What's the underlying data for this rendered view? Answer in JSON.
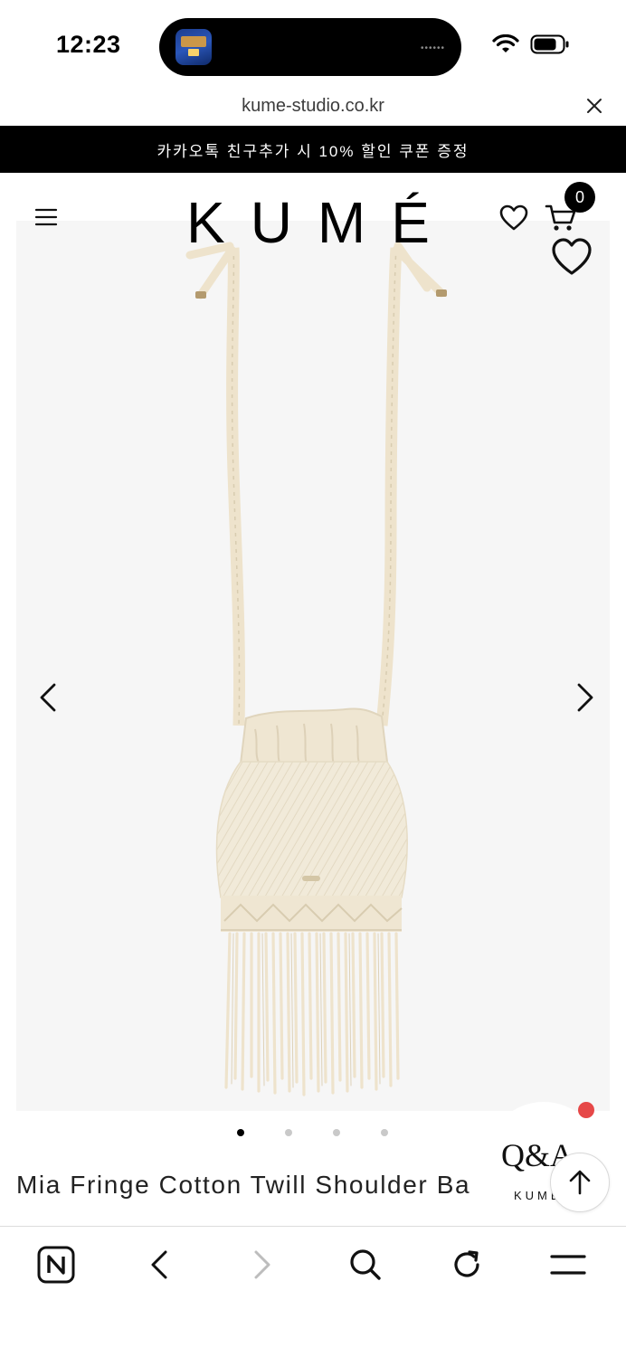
{
  "status_bar": {
    "time": "12:23"
  },
  "browser": {
    "url": "kume-studio.co.kr"
  },
  "promo": {
    "text": "카카오톡 친구추가 시 10% 할인 쿠폰 증정"
  },
  "header": {
    "logo": "KUMÉ",
    "cart_count": "0"
  },
  "gallery": {
    "current_index": 1,
    "total": 4
  },
  "product": {
    "title": "Mia Fringe Cotton Twill Shoulder Ba"
  },
  "qa": {
    "label": "Q&A",
    "sub": "KUME"
  },
  "colors": {
    "promo_bg": "#000000",
    "gallery_bg": "#f6f6f6",
    "notification_dot": "#e64848",
    "bag_cream": "#f1ead9"
  }
}
